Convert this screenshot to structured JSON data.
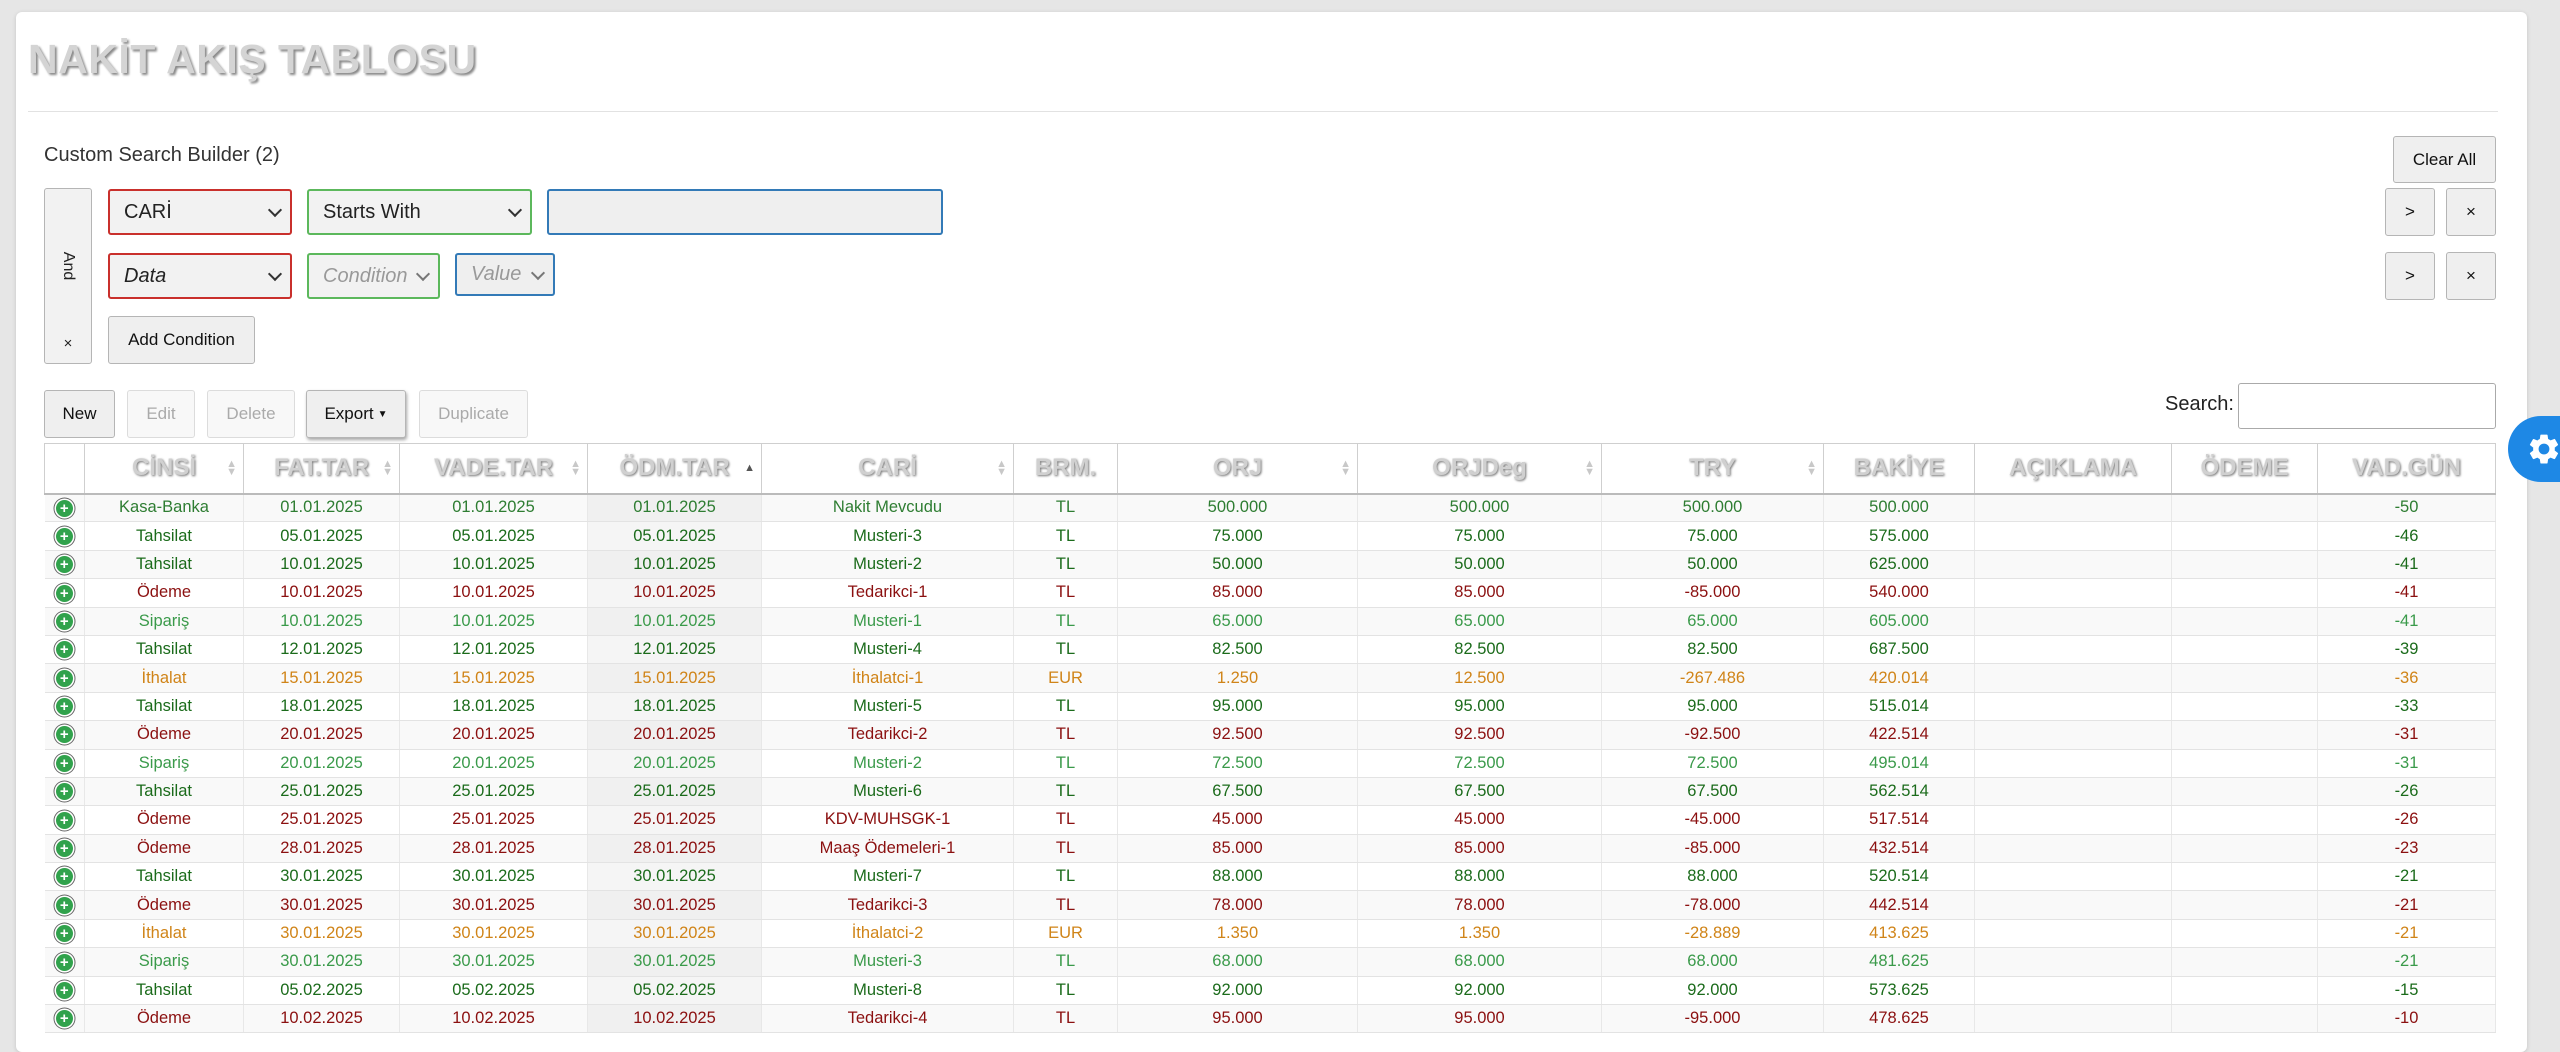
{
  "page": {
    "title": "NAKİT AKIŞ TABLOSU"
  },
  "search_builder": {
    "title": "Custom Search Builder (2)",
    "clear_all_label": "Clear All",
    "logic_label": "And",
    "logic_remove_label": "×",
    "add_condition_label": "Add Condition",
    "conditions": [
      {
        "data": "CARİ",
        "condition": "Starts With",
        "value": "",
        "next_label": ">",
        "remove_label": "×"
      },
      {
        "data": "Data",
        "condition": "Condition",
        "value": "Value",
        "next_label": ">",
        "remove_label": "×"
      }
    ]
  },
  "toolbar": {
    "new_label": "New",
    "edit_label": "Edit",
    "delete_label": "Delete",
    "export_label": "Export",
    "duplicate_label": "Duplicate",
    "search_label": "Search:",
    "search_value": ""
  },
  "table": {
    "columns": [
      "",
      "CİNSİ",
      "FAT.TAR",
      "VADE.TAR",
      "ÖDM.TAR",
      "CARİ",
      "BRM.",
      "ORJ",
      "ORJDeg",
      "TRY",
      "BAKİYE",
      "AÇIKLAMA",
      "ÖDEME",
      "VAD.GÜN"
    ],
    "sorted_column": "ÖDM.TAR",
    "rows": [
      {
        "cinsi": "Kasa-Banka",
        "fat_tar": "01.01.2025",
        "vade_tar": "01.01.2025",
        "odm_tar": "01.01.2025",
        "cari": "Nakit Mevcudu",
        "brm": "TL",
        "orj": "500.000",
        "orjdeg": "500.000",
        "try": "500.000",
        "bakiye": "500.000",
        "aciklama": "",
        "odeme": "",
        "vad_gun": "-50",
        "color": "#2e7d32"
      },
      {
        "cinsi": "Tahsilat",
        "fat_tar": "05.01.2025",
        "vade_tar": "05.01.2025",
        "odm_tar": "05.01.2025",
        "cari": "Musteri-3",
        "brm": "TL",
        "orj": "75.000",
        "orjdeg": "75.000",
        "try": "75.000",
        "bakiye": "575.000",
        "aciklama": "",
        "odeme": "",
        "vad_gun": "-46",
        "color": "#1b6b1b"
      },
      {
        "cinsi": "Tahsilat",
        "fat_tar": "10.01.2025",
        "vade_tar": "10.01.2025",
        "odm_tar": "10.01.2025",
        "cari": "Musteri-2",
        "brm": "TL",
        "orj": "50.000",
        "orjdeg": "50.000",
        "try": "50.000",
        "bakiye": "625.000",
        "aciklama": "",
        "odeme": "",
        "vad_gun": "-41",
        "color": "#1b6b1b"
      },
      {
        "cinsi": "Ödeme",
        "fat_tar": "10.01.2025",
        "vade_tar": "10.01.2025",
        "odm_tar": "10.01.2025",
        "cari": "Tedarikci-1",
        "brm": "TL",
        "orj": "85.000",
        "orjdeg": "85.000",
        "try": "-85.000",
        "bakiye": "540.000",
        "aciklama": "",
        "odeme": "",
        "vad_gun": "-41",
        "color": "#8b1010"
      },
      {
        "cinsi": "Sipariş",
        "fat_tar": "10.01.2025",
        "vade_tar": "10.01.2025",
        "odm_tar": "10.01.2025",
        "cari": "Musteri-1",
        "brm": "TL",
        "orj": "65.000",
        "orjdeg": "65.000",
        "try": "65.000",
        "bakiye": "605.000",
        "aciklama": "",
        "odeme": "",
        "vad_gun": "-41",
        "color": "#3a9a4a"
      },
      {
        "cinsi": "Tahsilat",
        "fat_tar": "12.01.2025",
        "vade_tar": "12.01.2025",
        "odm_tar": "12.01.2025",
        "cari": "Musteri-4",
        "brm": "TL",
        "orj": "82.500",
        "orjdeg": "82.500",
        "try": "82.500",
        "bakiye": "687.500",
        "aciklama": "",
        "odeme": "",
        "vad_gun": "-39",
        "color": "#1b6b1b"
      },
      {
        "cinsi": "İthalat",
        "fat_tar": "15.01.2025",
        "vade_tar": "15.01.2025",
        "odm_tar": "15.01.2025",
        "cari": "İthalatci-1",
        "brm": "EUR",
        "orj": "1.250",
        "orjdeg": "12.500",
        "try": "-267.486",
        "bakiye": "420.014",
        "aciklama": "",
        "odeme": "",
        "vad_gun": "-36",
        "color": "#d08418"
      },
      {
        "cinsi": "Tahsilat",
        "fat_tar": "18.01.2025",
        "vade_tar": "18.01.2025",
        "odm_tar": "18.01.2025",
        "cari": "Musteri-5",
        "brm": "TL",
        "orj": "95.000",
        "orjdeg": "95.000",
        "try": "95.000",
        "bakiye": "515.014",
        "aciklama": "",
        "odeme": "",
        "vad_gun": "-33",
        "color": "#1b6b1b"
      },
      {
        "cinsi": "Ödeme",
        "fat_tar": "20.01.2025",
        "vade_tar": "20.01.2025",
        "odm_tar": "20.01.2025",
        "cari": "Tedarikci-2",
        "brm": "TL",
        "orj": "92.500",
        "orjdeg": "92.500",
        "try": "-92.500",
        "bakiye": "422.514",
        "aciklama": "",
        "odeme": "",
        "vad_gun": "-31",
        "color": "#8b1010"
      },
      {
        "cinsi": "Sipariş",
        "fat_tar": "20.01.2025",
        "vade_tar": "20.01.2025",
        "odm_tar": "20.01.2025",
        "cari": "Musteri-2",
        "brm": "TL",
        "orj": "72.500",
        "orjdeg": "72.500",
        "try": "72.500",
        "bakiye": "495.014",
        "aciklama": "",
        "odeme": "",
        "vad_gun": "-31",
        "color": "#3a9a4a"
      },
      {
        "cinsi": "Tahsilat",
        "fat_tar": "25.01.2025",
        "vade_tar": "25.01.2025",
        "odm_tar": "25.01.2025",
        "cari": "Musteri-6",
        "brm": "TL",
        "orj": "67.500",
        "orjdeg": "67.500",
        "try": "67.500",
        "bakiye": "562.514",
        "aciklama": "",
        "odeme": "",
        "vad_gun": "-26",
        "color": "#1b6b1b"
      },
      {
        "cinsi": "Ödeme",
        "fat_tar": "25.01.2025",
        "vade_tar": "25.01.2025",
        "odm_tar": "25.01.2025",
        "cari": "KDV-MUHSGK-1",
        "brm": "TL",
        "orj": "45.000",
        "orjdeg": "45.000",
        "try": "-45.000",
        "bakiye": "517.514",
        "aciklama": "",
        "odeme": "",
        "vad_gun": "-26",
        "color": "#8b1010"
      },
      {
        "cinsi": "Ödeme",
        "fat_tar": "28.01.2025",
        "vade_tar": "28.01.2025",
        "odm_tar": "28.01.2025",
        "cari": "Maaş Ödemeleri-1",
        "brm": "TL",
        "orj": "85.000",
        "orjdeg": "85.000",
        "try": "-85.000",
        "bakiye": "432.514",
        "aciklama": "",
        "odeme": "",
        "vad_gun": "-23",
        "color": "#8b1010"
      },
      {
        "cinsi": "Tahsilat",
        "fat_tar": "30.01.2025",
        "vade_tar": "30.01.2025",
        "odm_tar": "30.01.2025",
        "cari": "Musteri-7",
        "brm": "TL",
        "orj": "88.000",
        "orjdeg": "88.000",
        "try": "88.000",
        "bakiye": "520.514",
        "aciklama": "",
        "odeme": "",
        "vad_gun": "-21",
        "color": "#1b6b1b"
      },
      {
        "cinsi": "Ödeme",
        "fat_tar": "30.01.2025",
        "vade_tar": "30.01.2025",
        "odm_tar": "30.01.2025",
        "cari": "Tedarikci-3",
        "brm": "TL",
        "orj": "78.000",
        "orjdeg": "78.000",
        "try": "-78.000",
        "bakiye": "442.514",
        "aciklama": "",
        "odeme": "",
        "vad_gun": "-21",
        "color": "#8b1010"
      },
      {
        "cinsi": "İthalat",
        "fat_tar": "30.01.2025",
        "vade_tar": "30.01.2025",
        "odm_tar": "30.01.2025",
        "cari": "İthalatci-2",
        "brm": "EUR",
        "orj": "1.350",
        "orjdeg": "1.350",
        "try": "-28.889",
        "bakiye": "413.625",
        "aciklama": "",
        "odeme": "",
        "vad_gun": "-21",
        "color": "#d08418"
      },
      {
        "cinsi": "Sipariş",
        "fat_tar": "30.01.2025",
        "vade_tar": "30.01.2025",
        "odm_tar": "30.01.2025",
        "cari": "Musteri-3",
        "brm": "TL",
        "orj": "68.000",
        "orjdeg": "68.000",
        "try": "68.000",
        "bakiye": "481.625",
        "aciklama": "",
        "odeme": "",
        "vad_gun": "-21",
        "color": "#3a9a4a"
      },
      {
        "cinsi": "Tahsilat",
        "fat_tar": "05.02.2025",
        "vade_tar": "05.02.2025",
        "odm_tar": "05.02.2025",
        "cari": "Musteri-8",
        "brm": "TL",
        "orj": "92.000",
        "orjdeg": "92.000",
        "try": "92.000",
        "bakiye": "573.625",
        "aciklama": "",
        "odeme": "",
        "vad_gun": "-15",
        "color": "#1b6b1b"
      },
      {
        "cinsi": "Ödeme",
        "fat_tar": "10.02.2025",
        "vade_tar": "10.02.2025",
        "odm_tar": "10.02.2025",
        "cari": "Tedarikci-4",
        "brm": "TL",
        "orj": "95.000",
        "orjdeg": "95.000",
        "try": "-95.000",
        "bakiye": "478.625",
        "aciklama": "",
        "odeme": "",
        "vad_gun": "-10",
        "color": "#8b1010"
      }
    ]
  },
  "icons": {
    "row_expand": "plus-circle-icon",
    "settings": "gear-icon",
    "dropdown": "chevron-down-icon",
    "sort": "sort-icon"
  },
  "colors": {
    "accent": "#1e88e5",
    "tahsilat": "#1b6b1b",
    "odeme": "#8b1010",
    "ithalat": "#d08418",
    "siparis": "#3a9a4a",
    "kasa": "#2e7d32"
  }
}
